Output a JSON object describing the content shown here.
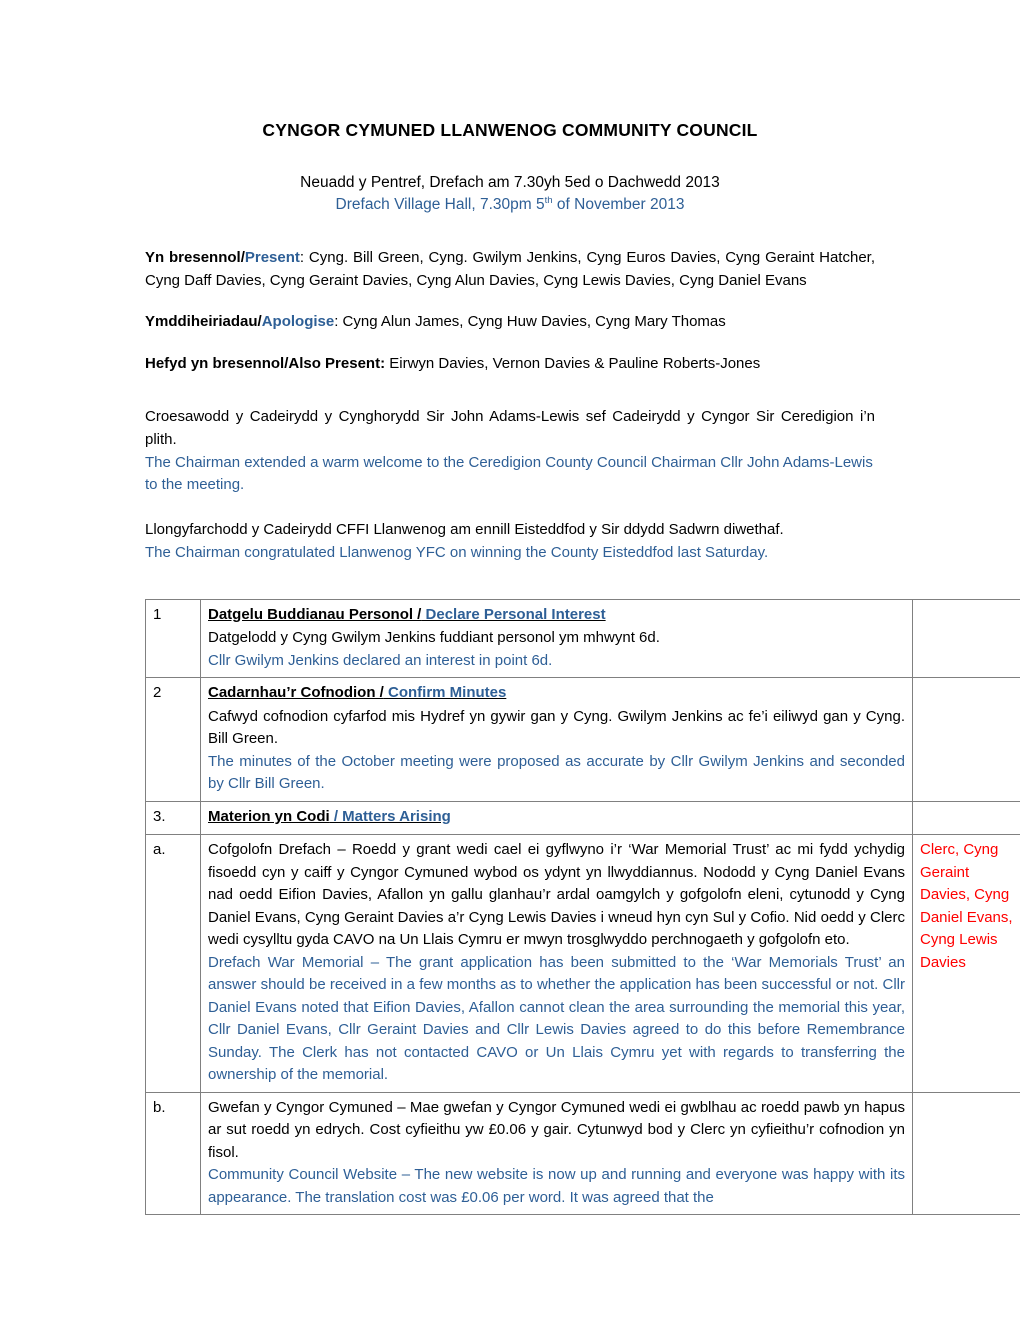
{
  "document": {
    "title": "CYNGOR CYMUNED LLANWENOG COMMUNITY COUNCIL",
    "subtitle_cy": "Neuadd y Pentref, Drefach am 7.30yh 5ed o Dachwedd 2013",
    "subtitle_en_before": "Drefach Village Hall, 7.30pm 5",
    "subtitle_en_sup": "th",
    "subtitle_en_after": " of November 2013",
    "colors": {
      "welsh_text": "#000000",
      "english_text": "#2e5f96",
      "action_text": "#ff0000",
      "table_border": "#808080"
    }
  },
  "attendance": {
    "present": {
      "label_cy": "Yn bresennol/",
      "label_en": "Present",
      "value": ": Cyng. Bill Green, Cyng. Gwilym Jenkins, Cyng Euros Davies, Cyng Geraint Hatcher, Cyng Daff Davies, Cyng Geraint Davies, Cyng Alun Davies, Cyng Lewis Davies, Cyng Daniel Evans"
    },
    "apologies": {
      "label_cy": "Ymddiheiriadau/",
      "label_en": "Apologise",
      "value": ": Cyng Alun James, Cyng Huw Davies, Cyng Mary Thomas"
    },
    "also_present": {
      "label_cy": "Hefyd yn bresennol/Also Present:",
      "value": " Eirwyn Davies, Vernon Davies & Pauline Roberts-Jones"
    }
  },
  "narrative": {
    "welcome_cy": "Croesawodd y Cadeirydd y Cynghorydd Sir John Adams-Lewis sef Cadeirydd y Cyngor Sir Ceredigion i’n plith.",
    "welcome_en": "The Chairman extended a warm welcome to the Ceredigion County Council Chairman Cllr John Adams-Lewis to the meeting.",
    "congrats_cy": "Llongyfarchodd y Cadeirydd CFFI Llanwenog am ennill Eisteddfod y Sir ddydd Sadwrn diwethaf.",
    "congrats_en": "The Chairman congratulated Llanwenog YFC on winning the County Eisteddfod last Saturday."
  },
  "minutes": {
    "rows": [
      {
        "number": "1",
        "heading_cy": "Datgelu Buddianau Personol /",
        "heading_en": " Declare Personal Interest",
        "lines": [
          {
            "text": "Datgelodd y Cyng Gwilym Jenkins fuddiant personol ym mhwynt 6d.",
            "lang": "cy"
          },
          {
            "text": "Cllr Gwilym Jenkins declared an interest in point 6d.",
            "lang": "en"
          }
        ],
        "action": ""
      },
      {
        "number": "2",
        "heading_cy": "Cadarnhau’r Cofnodion /",
        "heading_en": " Confirm Minutes",
        "lines": [
          {
            "text": "Cafwyd cofnodion cyfarfod mis Hydref yn gywir gan y Cyng. Gwilym Jenkins ac fe’i eiliwyd gan y Cyng. Bill Green.",
            "lang": "cy"
          },
          {
            "text": "The minutes of the October meeting were proposed as accurate by Cllr Gwilym Jenkins and seconded by Cllr Bill Green.",
            "lang": "en"
          }
        ],
        "action": ""
      },
      {
        "number": "3.",
        "heading_cy": "Materion yn Codi",
        "heading_en": " / Matters Arising",
        "lines": [],
        "action": ""
      }
    ],
    "sub_rows": [
      {
        "number": "a.",
        "lines": [
          {
            "text": "Cofgolofn Drefach – Roedd y grant wedi cael ei gyflwyno i’r ‘War Memorial Trust’ ac mi fydd ychydig fisoedd cyn y caiff y Cyngor Cymuned wybod os ydynt yn llwyddiannus. Nododd y Cyng Daniel Evans nad oedd Eifion Davies, Afallon yn gallu glanhau’r ardal oamgylch y gofgolofn eleni, cytunodd y Cyng Daniel Evans, Cyng Geraint Davies a’r Cyng Lewis Davies i wneud hyn cyn Sul y Cofio. Nid oedd y Clerc wedi cysylltu gyda CAVO na Un Llais Cymru er mwyn trosglwyddo perchnogaeth y gofgolofn eto.",
            "lang": "cy"
          },
          {
            "text": "Drefach War Memorial – The grant application has been submitted to the ‘War Memorials Trust’ an answer should be received in a few months as to whether the application has been successful or not.  Cllr Daniel Evans noted that Eifion Davies, Afallon cannot clean the area surrounding the memorial this year, Cllr Daniel Evans, Cllr Geraint Davies and Cllr Lewis Davies agreed to do this before Remembrance Sunday. The Clerk has not contacted CAVO or Un Llais Cymru yet with regards to transferring the ownership of the memorial.",
            "lang": "en"
          }
        ],
        "action": "Clerc, Cyng Geraint Davies, Cyng Daniel Evans, Cyng Lewis Davies"
      },
      {
        "number": "b.",
        "lines": [
          {
            "text": "Gwefan y Cyngor Cymuned – Mae gwefan y Cyngor Cymuned wedi ei gwblhau ac roedd pawb yn hapus ar sut roedd yn edrych. Cost cyfieithu yw £0.06 y gair. Cytunwyd bod y Clerc yn cyfieithu’r cofnodion yn fisol.",
            "lang": "cy"
          },
          {
            "text": "Community Council Website – The new website is now up and running and everyone was happy with its appearance. The translation cost was £0.06 per word. It was agreed that the",
            "lang": "en"
          }
        ],
        "action": ""
      }
    ]
  }
}
